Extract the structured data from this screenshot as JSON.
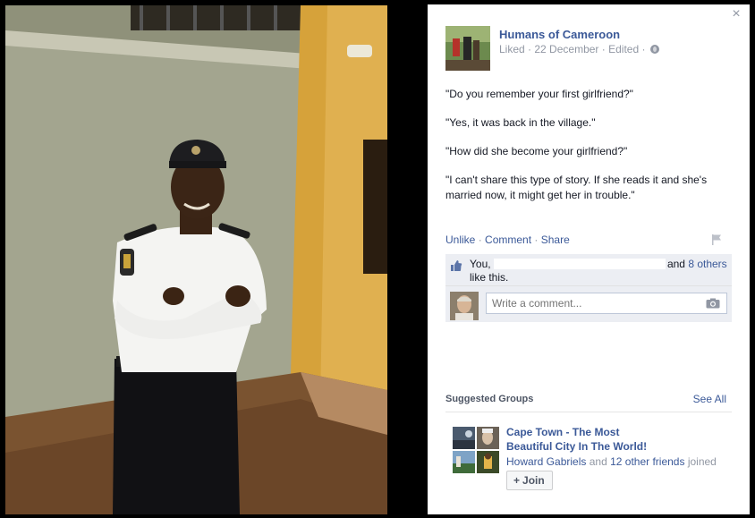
{
  "post": {
    "page_name": "Humans of Cameroon",
    "meta_liked": "Liked",
    "meta_date": "22 December",
    "meta_edited": "Edited",
    "paragraphs": [
      "\"Do you remember your first girlfriend?\"",
      "\"Yes, it was back in the village.\"",
      "\"How did she become your girlfriend?\"",
      "\"I can't share this type of story. If she reads it and she's married now, it might get her in trouble.\""
    ]
  },
  "actions": {
    "unlike": "Unlike",
    "comment": "Comment",
    "share": "Share",
    "separator": "·"
  },
  "likes": {
    "you": "You,",
    "and": "and",
    "others": "8 others",
    "suffix": "like this."
  },
  "comment": {
    "placeholder": "Write a comment..."
  },
  "suggested": {
    "title": "Suggested Groups",
    "see_all": "See All",
    "group": {
      "name_line1": "Cape Town - The Most",
      "name_line2": "Beautiful City In The World!",
      "member": "Howard Gabriels",
      "and": "and",
      "others": "12 other friends",
      "joined": "joined",
      "join_label": "Join",
      "join_plus": "+"
    }
  },
  "close": {
    "glyph": "×"
  },
  "icons": {
    "close": "close-icon",
    "globe": "globe-icon",
    "flag": "flag-icon",
    "thumb": "thumbs-up-icon",
    "camera": "camera-icon"
  },
  "colors": {
    "link": "#3b5998",
    "meta": "#9197a3",
    "likes_bg": "#eceef3",
    "backdrop": "#000000"
  }
}
